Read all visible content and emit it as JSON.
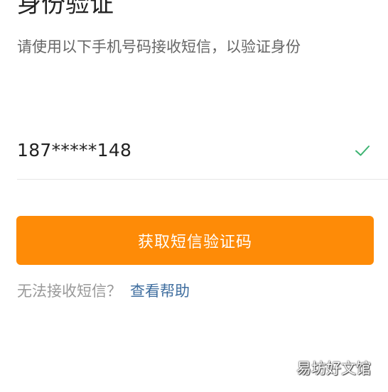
{
  "header": {
    "title": "身份验证",
    "subtitle": "请使用以下手机号码接收短信，以验证身份"
  },
  "phone": {
    "number": "187*****148",
    "status_icon": "checkmark-icon",
    "status_color": "#3cb371"
  },
  "actions": {
    "send_code_label": "获取短信验证码",
    "button_color": "#fe8b07"
  },
  "help": {
    "prefix": "无法接收短信？",
    "link_label": "查看帮助",
    "link_color": "#3f6e9f"
  },
  "watermark": {
    "text": "易坊好文馆"
  }
}
